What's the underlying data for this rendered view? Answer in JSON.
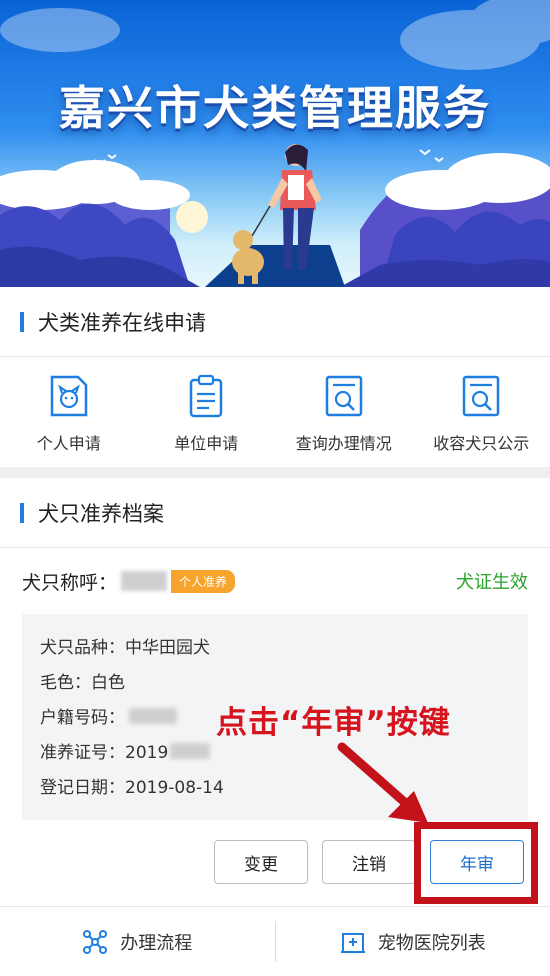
{
  "banner": {
    "title": "嘉兴市犬类管理服务"
  },
  "apply_section": {
    "title": "犬类准养在线申请",
    "items": [
      {
        "label": "个人申请",
        "icon": "dog-face-doc-icon"
      },
      {
        "label": "单位申请",
        "icon": "clipboard-icon"
      },
      {
        "label": "查询办理情况",
        "icon": "search-document-icon"
      },
      {
        "label": "收容犬只公示",
        "icon": "search-document-icon"
      }
    ]
  },
  "record_section": {
    "title": "犬只准养档案",
    "name_label": "犬只称呼：",
    "badge": "个人准养",
    "status": "犬证生效",
    "status_color": "#2aa32a",
    "info": {
      "breed": "犬只品种：中华田园犬",
      "color": "毛色：白色",
      "household_label": "户籍号码：",
      "license_label": "准养证号：2019",
      "register_date": "登记日期：2019-08-14"
    },
    "buttons": {
      "change": "变更",
      "cancel": "注销",
      "annual": "年审"
    }
  },
  "annotation": {
    "text": "点击“年审”按键",
    "color": "#d6141d"
  },
  "bottom_nav": {
    "process": "办理流程",
    "hospitals": "宠物医院列表"
  },
  "colors": {
    "accent": "#1f7fe0",
    "badge": "#f7a42c"
  }
}
